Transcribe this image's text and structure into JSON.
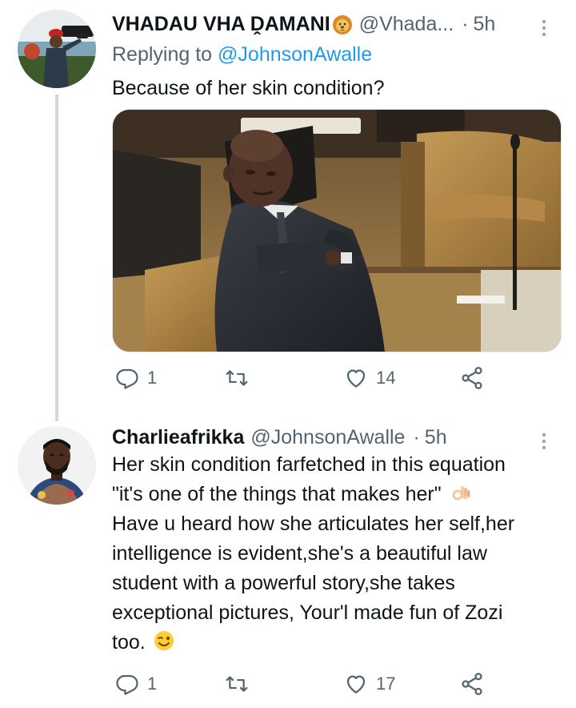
{
  "thread": [
    {
      "author": {
        "display_name": "VHADAU VHA ḒAMANI",
        "name_emoji": "lion-face-emoji",
        "handle": "@Vhada...",
        "separator": "·",
        "time": "5h"
      },
      "replying_to": {
        "prefix": "Replying to ",
        "mention": "@JohnsonAwalle"
      },
      "text": "Because of her skin condition?",
      "media": "photo-man-in-parliament-arms-crossed",
      "actions": {
        "reply_count": "1",
        "retweet_count": "",
        "like_count": "14"
      }
    },
    {
      "author": {
        "display_name": "Charlieafrikka",
        "handle": "@JohnsonAwalle",
        "separator": "·",
        "time": "5h"
      },
      "text_lines": [
        "Her skin condition farfetched in this equation",
        "\"it's one of the things that makes her\"",
        "Have u heard  how she articulates her self,her",
        "intelligence is evident,she's a beautiful law",
        "student with a powerful story,she takes",
        "exceptional pictures, Your'l made fun of Zozi",
        "too."
      ],
      "line_emojis": {
        "line2": "ok-hand-light-skin-emoji",
        "line7": "winking-face-emoji"
      },
      "actions": {
        "reply_count": "1",
        "retweet_count": "",
        "like_count": "17"
      }
    }
  ],
  "colors": {
    "text_primary": "#0f1419",
    "text_secondary": "#536471",
    "link": "#1d9bf0",
    "thread_line": "#cfd9de"
  }
}
